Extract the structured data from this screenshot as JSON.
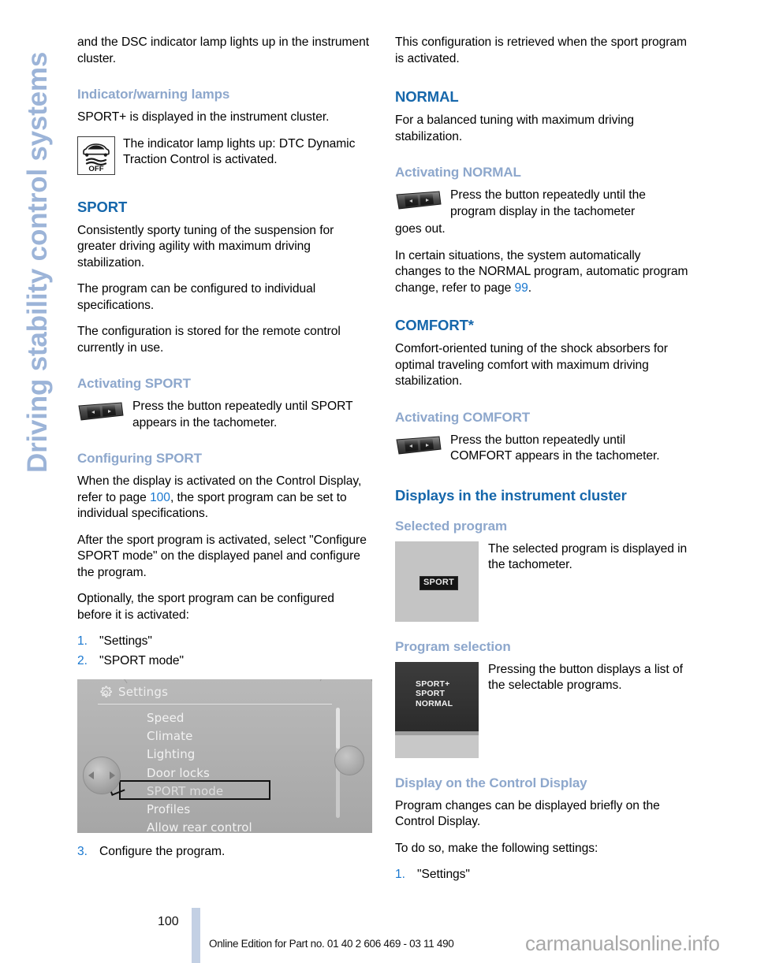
{
  "sidebar": {
    "chapter_title": "Driving stability control systems",
    "color": "#9cb4d8"
  },
  "left_column": {
    "intro_paragraph": "and the DSC indicator lamp lights up in the instrument cluster.",
    "indicator_heading": "Indicator/warning lamps",
    "indicator_paragraph": "SPORT+ is displayed in the instrument cluster.",
    "lamp_caption": "The indicator lamp lights up: DTC Dynamic Traction Control is activated.",
    "lamp_icon_label": "OFF",
    "sport_heading": "SPORT",
    "sport_p1": "Consistently sporty tuning of the suspension for greater driving agility with maximum driving stabilization.",
    "sport_p2": "The program can be configured to individual specifications.",
    "sport_p3": "The configuration is stored for the remote control currently in use.",
    "activating_sport_heading": "Activating SPORT",
    "activating_sport_caption": "Press the button repeatedly until SPORT appears in the tachometer.",
    "configuring_sport_heading": "Configuring SPORT",
    "configuring_p1_before": "When the display is activated on the Control Display, refer to page ",
    "configuring_p1_ref": "100",
    "configuring_p1_after": ", the sport program can be set to individual specifications.",
    "configuring_p2": "After the sport program is activated, select \"Configure SPORT mode\" on the displayed panel and configure the program.",
    "configuring_p3": "Optionally, the sport program can be configured before it is activated:",
    "steps": [
      {
        "num": "1.",
        "text": "\"Settings\""
      },
      {
        "num": "2.",
        "text": "\"SPORT mode\""
      }
    ],
    "step3": {
      "num": "3.",
      "text": "Configure the program."
    }
  },
  "idrive_screenshot": {
    "title": "Settings",
    "menu_items": [
      "Speed",
      "Climate",
      "Lighting",
      "Door locks",
      "SPORT mode",
      "Profiles",
      "Allow rear control"
    ],
    "selected_item": "SPORT mode"
  },
  "right_column": {
    "intro_paragraph": "This configuration is retrieved when the sport program is activated.",
    "normal_heading": "NORMAL",
    "normal_p1": "For a balanced tuning with maximum driving stabilization.",
    "activating_normal_heading": "Activating NORMAL",
    "activating_normal_caption": "Press the button repeatedly until the program display in the tachometer",
    "activating_normal_tail": "goes out.",
    "normal_p2_before": "In certain situations, the system automatically changes to the NORMAL program, automatic program change, refer to page ",
    "normal_p2_ref": "99",
    "normal_p2_after": ".",
    "comfort_heading": "COMFORT*",
    "comfort_p1": "Comfort-oriented tuning of the shock absorbers for optimal traveling comfort with maximum driving stabilization.",
    "activating_comfort_heading": "Activating COMFORT",
    "activating_comfort_caption": "Press the button repeatedly until COMFORT appears in the tachometer.",
    "displays_heading": "Displays in the instrument cluster",
    "selected_program_heading": "Selected program",
    "selected_program_caption": "The selected program is displayed in the tachometer.",
    "selected_program_badge": "SPORT",
    "program_selection_heading": "Program selection",
    "program_selection_caption": "Pressing the button displays a list of the selectable programs.",
    "program_list": [
      "SPORT+",
      "SPORT",
      "NORMAL"
    ],
    "control_display_heading": "Display on the Control Display",
    "control_display_p1": "Program changes can be displayed briefly on the Control Display.",
    "control_display_p2": "To do so, make the following settings:",
    "steps": [
      {
        "num": "1.",
        "text": "\"Settings\""
      }
    ]
  },
  "footer": {
    "page_number": "100",
    "edition_text": "Online Edition for Part no. 01 40 2 606 469 - 03 11 490",
    "watermark": "carmanualsonline.info"
  },
  "colors": {
    "heading_dark_blue": "#1667ab",
    "heading_light_blue": "#8da7cc",
    "reference_link": "#1a78d0",
    "footer_bar": "#c3d0e4"
  }
}
